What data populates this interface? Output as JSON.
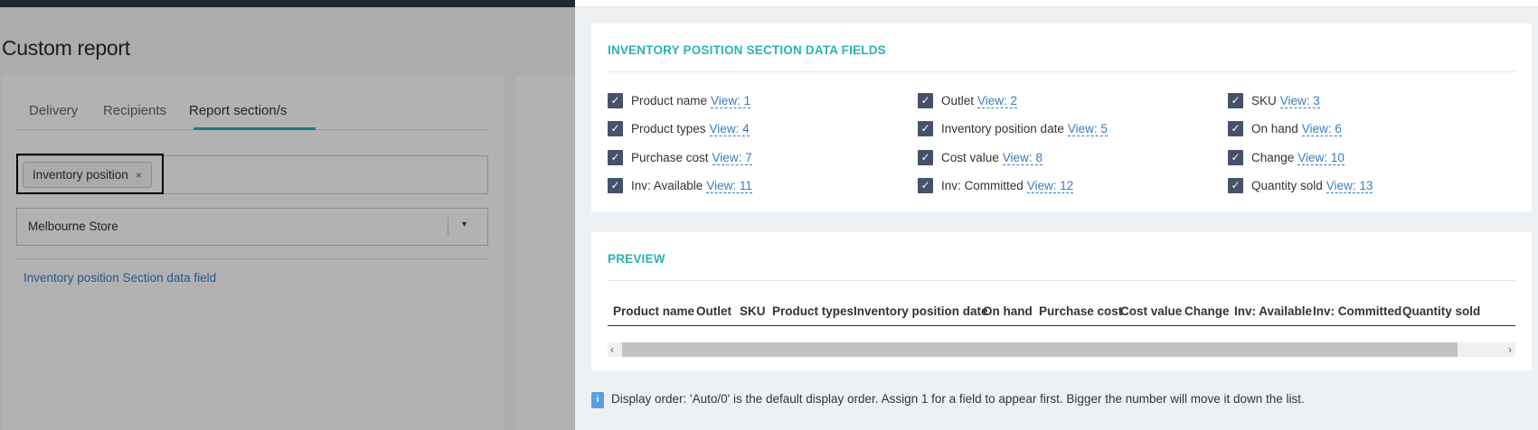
{
  "background": {
    "page_title": "Custom report",
    "tabs": [
      "Delivery",
      "Recipients",
      "Report section/s"
    ],
    "selected_chip": "Inventory position",
    "chip_remove": "×",
    "outlet_select": "Melbourne Store",
    "select_arrow": "▾",
    "section_link": "Inventory position Section data field"
  },
  "fields_section": {
    "title": "INVENTORY POSITION SECTION DATA FIELDS",
    "check_glyph": "✓",
    "fields": [
      {
        "label": "Product name",
        "view": "View: 1"
      },
      {
        "label": "Outlet",
        "view": "View: 2"
      },
      {
        "label": "SKU",
        "view": "View: 3"
      },
      {
        "label": "Product types",
        "view": "View: 4"
      },
      {
        "label": "Inventory position date",
        "view": "View: 5"
      },
      {
        "label": "On hand",
        "view": "View: 6"
      },
      {
        "label": "Purchase cost",
        "view": "View: 7"
      },
      {
        "label": "Cost value",
        "view": "View: 8"
      },
      {
        "label": "Change",
        "view": "View: 10"
      },
      {
        "label": "Inv: Available",
        "view": "View: 11"
      },
      {
        "label": "Inv: Committed",
        "view": "View: 12"
      },
      {
        "label": "Quantity sold",
        "view": "View: 13"
      }
    ]
  },
  "preview_section": {
    "title": "PREVIEW",
    "columns": [
      "Product name",
      "Outlet",
      "SKU",
      "Product types",
      "Inventory position date",
      "On hand",
      "Purchase cost",
      "Cost value",
      "Change",
      "Inv: Available",
      "Inv: Committed",
      "Quantity sold"
    ],
    "scroll_left": "‹",
    "scroll_right": "›"
  },
  "info": {
    "icon": "i",
    "text": "Display order: 'Auto/0' is the default display order. Assign 1 for a field to appear first. Bigger the number will move it down the list."
  }
}
